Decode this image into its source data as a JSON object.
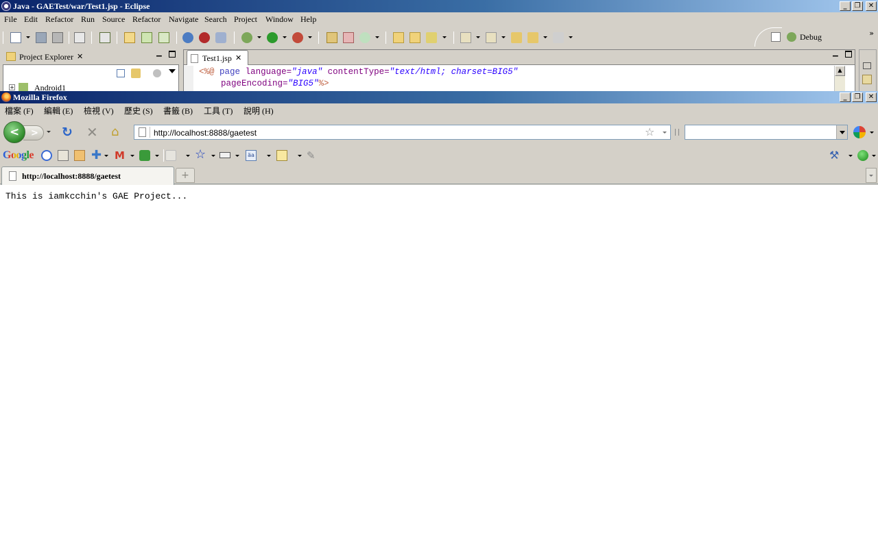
{
  "eclipse": {
    "title": "Java - GAETest/war/Test1.jsp - Eclipse",
    "menu": [
      "File",
      "Edit",
      "Refactor",
      "Run",
      "Source",
      "Refactor",
      "Navigate",
      "Search",
      "Project",
      "Window",
      "Help"
    ],
    "perspective_label": "Debug",
    "project_explorer": {
      "tab_label": "Project Explorer",
      "tree_item": "Android1"
    },
    "editor": {
      "tab_label": "Test1.jsp",
      "line1": {
        "open": "<%@",
        "directive": "page",
        "attr1": "language=",
        "val1": "\"java\"",
        "attr2": "contentType=",
        "val2": "\"text/html; charset=BIG5\""
      },
      "line2": {
        "attr": "pageEncoding=",
        "val": "\"BIG5\"",
        "close": "%>"
      }
    }
  },
  "firefox": {
    "title": "Mozilla Firefox",
    "menu": [
      "檔案 (F)",
      "編輯 (E)",
      "檢視 (V)",
      "歷史 (S)",
      "書籤 (B)",
      "工具 (T)",
      "說明 (H)"
    ],
    "url": "http://localhost:8888/gaetest",
    "search_placeholder": "",
    "google_logo": "Google",
    "tab_title": "http://localhost:8888/gaetest",
    "page_text": "This is iamkcchin's GAE Project..."
  }
}
